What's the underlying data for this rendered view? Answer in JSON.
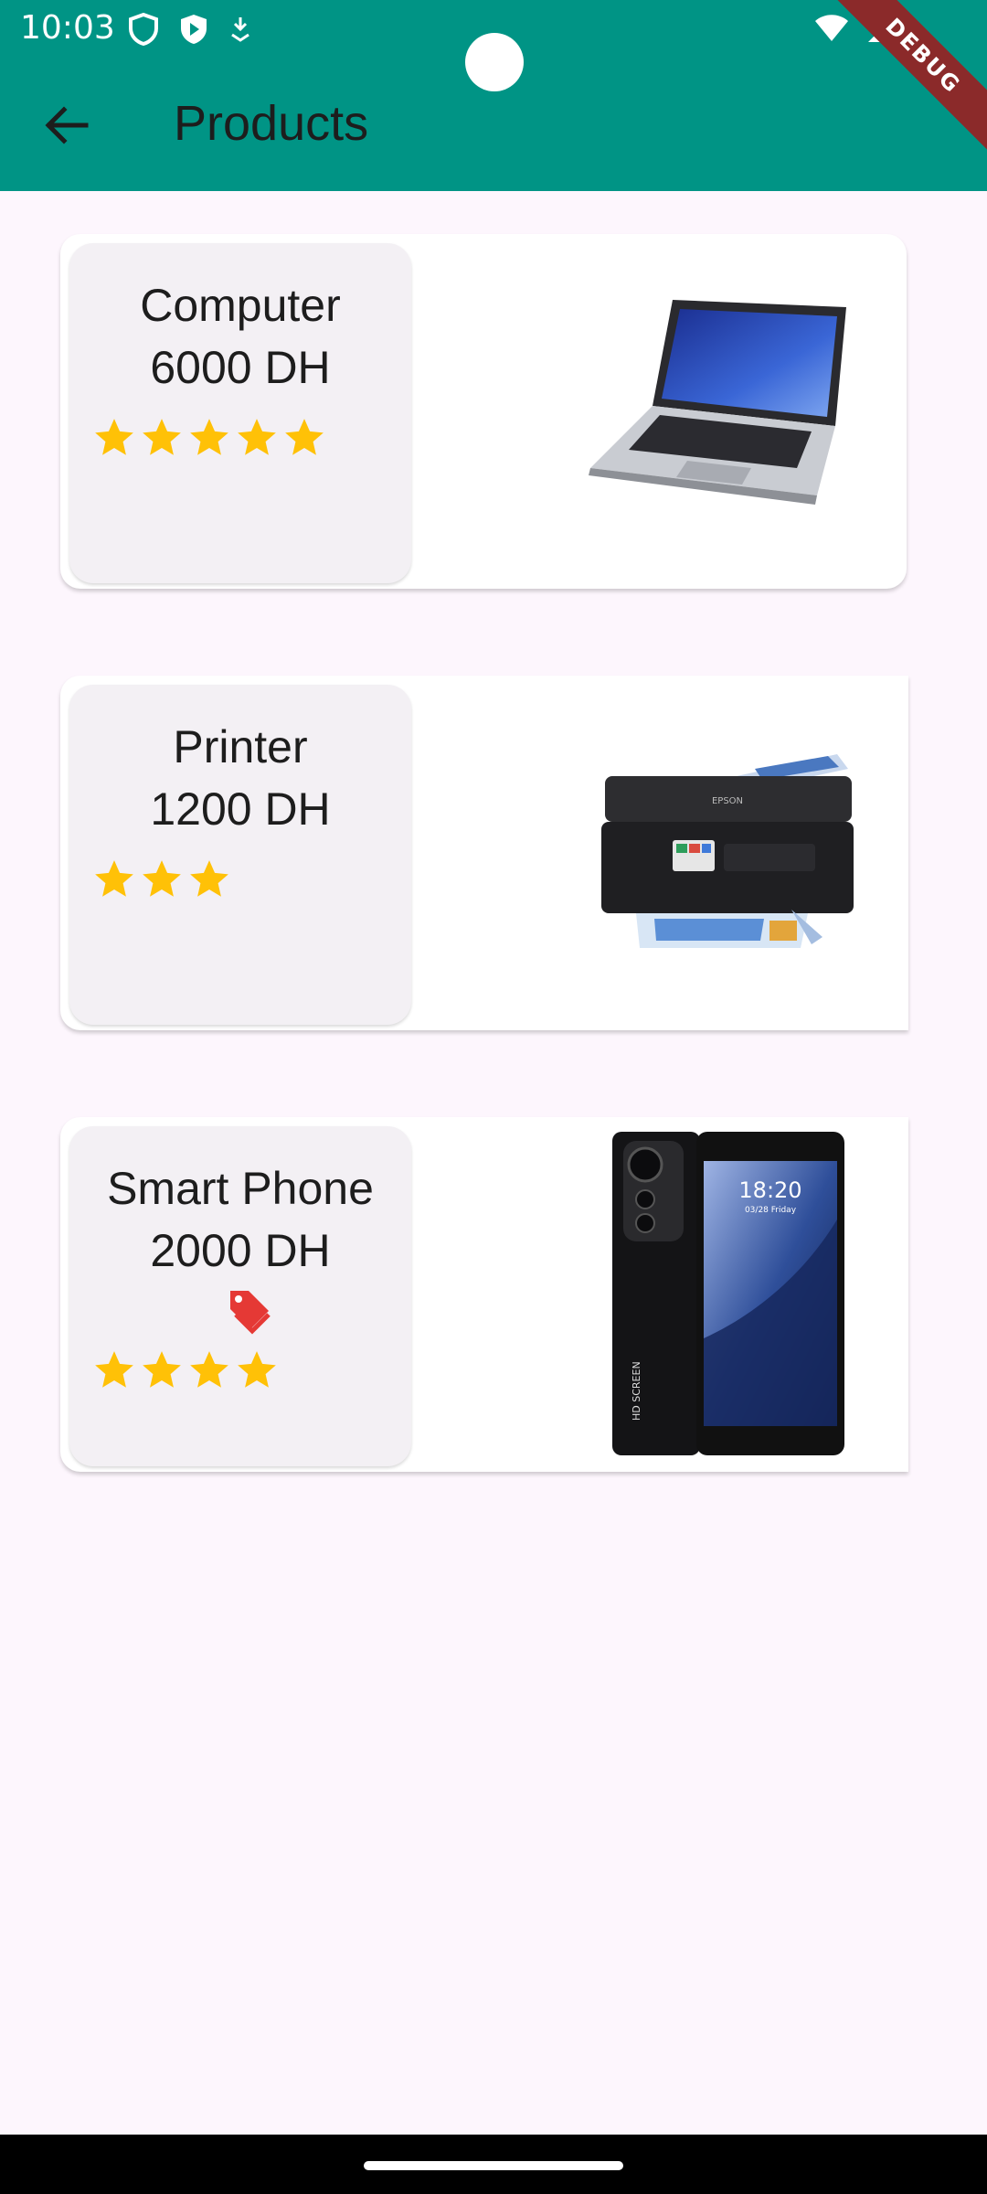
{
  "status_bar": {
    "time": "10:03"
  },
  "debug_banner": "DEBUG",
  "app_bar": {
    "title": "Products"
  },
  "colors": {
    "app_bar": "#009485",
    "star": "#ffc107",
    "tag": "#e53935",
    "background": "#fdf6fd"
  },
  "products": [
    {
      "name": "Computer",
      "price": "6000 DH",
      "rating": 5,
      "on_sale": false,
      "image_icon": "laptop-image"
    },
    {
      "name": "Printer",
      "price": "1200 DH",
      "rating": 3,
      "on_sale": false,
      "image_icon": "printer-image"
    },
    {
      "name": "Smart Phone",
      "price": "2000 DH",
      "rating": 4,
      "on_sale": true,
      "image_icon": "smartphone-image"
    }
  ],
  "phone_screen": {
    "time": "18:20",
    "date": "03/28 Friday",
    "side_text": "HD SCREEN"
  },
  "printer_brand": "EPSON"
}
